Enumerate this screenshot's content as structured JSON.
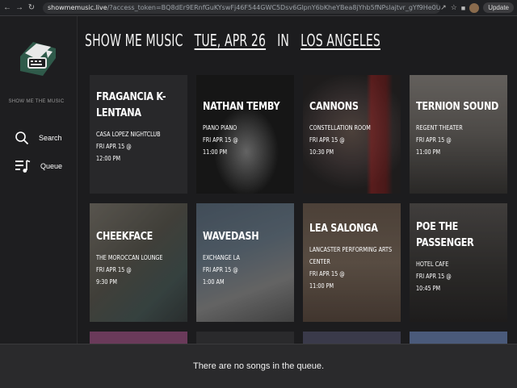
{
  "browser": {
    "url_host": "showmemusic.live",
    "url_path": "/?access_token=BQ8dEr9ERnfGuKYswFj46F544GWC5Dsv6GlpnY6bKheYBea8jYhb5fNPslajtvr_gYf9He0UFZlGxVWEpSVZT...",
    "update_label": "Update"
  },
  "sidebar": {
    "logo_text": "SHOW ME THE MUSIC",
    "search_label": "Search",
    "queue_label": "Queue"
  },
  "header": {
    "title": "SHOW ME MUSIC",
    "date": "TUE, APR 26",
    "in_word": "IN",
    "city": "LOS ANGELES"
  },
  "events": [
    {
      "name": "FRAGANCIA K-LENTANA",
      "venue": "CASA LOPEZ NIGHTCLUB",
      "date": "FRI APR 15 @",
      "time": "12:00 PM"
    },
    {
      "name": "NATHAN TEMBY",
      "venue": "PIANO PIANO",
      "date": "FRI APR 15 @",
      "time": "11:00 PM"
    },
    {
      "name": "CANNONS",
      "venue": "CONSTELLATION ROOM",
      "date": "FRI APR 15 @",
      "time": "10:30 PM"
    },
    {
      "name": "TERNION SOUND",
      "venue": "REGENT THEATER",
      "date": "FRI APR 15 @",
      "time": "11:00 PM"
    },
    {
      "name": "CHEEKFACE",
      "venue": "THE MOROCCAN LOUNGE",
      "date": "FRI APR 15 @",
      "time": "9:30 PM"
    },
    {
      "name": "WAVEDASH",
      "venue": "EXCHANGE LA",
      "date": "FRI APR 15 @",
      "time": "1:00 AM"
    },
    {
      "name": "LEA SALONGA",
      "venue": "LANCASTER PERFORMING ARTS CENTER",
      "date": "FRI APR 15 @",
      "time": "11:00 PM"
    },
    {
      "name": "POE THE PASSENGER",
      "venue": "HOTEL CAFE",
      "date": "FRI APR 15 @",
      "time": "10:45 PM"
    }
  ],
  "queue": {
    "empty_message": "There are no songs in the queue."
  },
  "colors": {
    "background": "#1c1c1e",
    "card": "#2b2b2d",
    "logo_accent": "#2f5a4a"
  }
}
